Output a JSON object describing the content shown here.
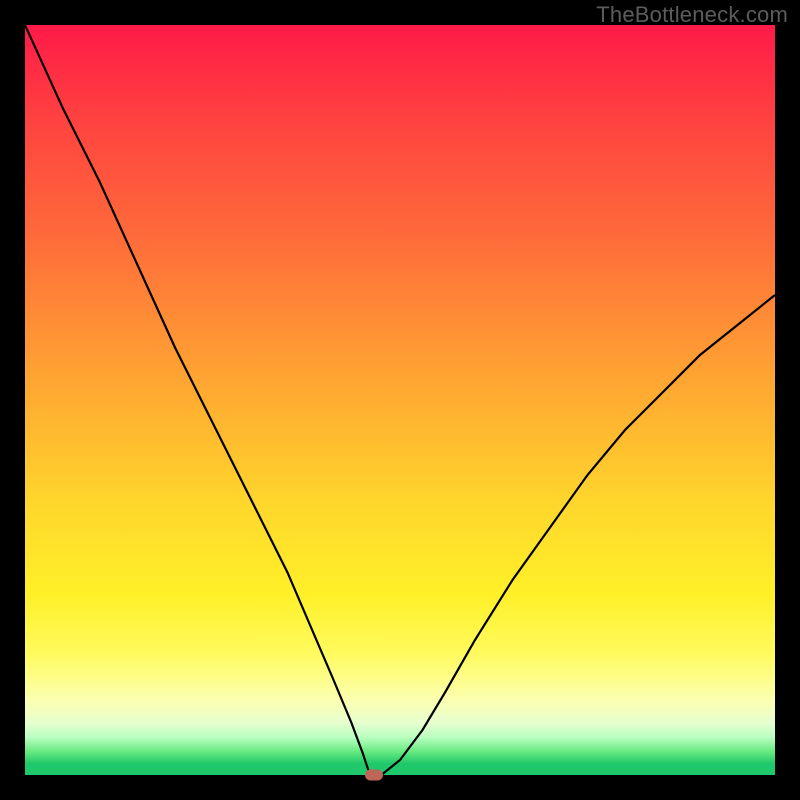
{
  "watermark": "TheBottleneck.com",
  "chart_data": {
    "type": "line",
    "title": "",
    "xlabel": "",
    "ylabel": "",
    "xlim": [
      0,
      100
    ],
    "ylim": [
      0,
      100
    ],
    "grid": false,
    "background": "vertical-gradient red→orange→yellow→green",
    "series": [
      {
        "name": "bottleneck-curve",
        "x": [
          0,
          5,
          10,
          15,
          20,
          25,
          30,
          35,
          38,
          41,
          43.5,
          45,
          46,
          47.5,
          50,
          53,
          56,
          60,
          65,
          70,
          75,
          80,
          85,
          90,
          95,
          100
        ],
        "values": [
          100,
          89,
          79,
          68,
          57,
          47,
          37,
          27,
          20,
          13,
          7,
          3,
          0,
          0,
          2,
          6,
          11,
          18,
          26,
          33,
          40,
          46,
          51,
          56,
          60,
          64
        ]
      }
    ],
    "marker": {
      "name": "optimal-point",
      "x": 46.5,
      "y": 0,
      "shape": "pill",
      "color": "#bd6759"
    }
  }
}
